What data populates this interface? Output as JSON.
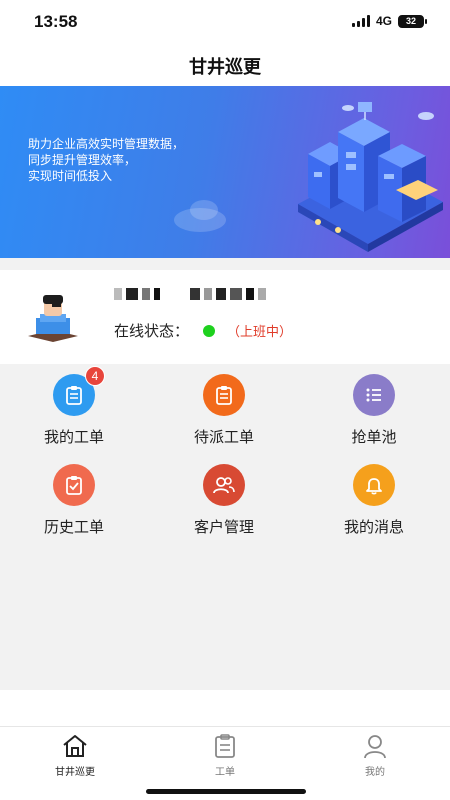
{
  "status_bar": {
    "time": "13:58",
    "network": "4G",
    "battery": "32"
  },
  "header": {
    "title": "甘井巡更"
  },
  "banner": {
    "lines": [
      "助力企业高效实时管理数据，",
      "同步提升管理效率，",
      "实现时间低投入"
    ]
  },
  "user": {
    "status_label": "在线状态：",
    "status_value": "（上班中）",
    "status_color": "#1ed11e"
  },
  "menu": [
    {
      "label": "我的工单",
      "icon": "clipboard-icon",
      "color": "#2e9bf0",
      "badge": "4"
    },
    {
      "label": "待派工单",
      "icon": "clipboard-icon",
      "color": "#f26a1b"
    },
    {
      "label": "抢单池",
      "icon": "list-icon",
      "color": "#8a7cc9"
    },
    {
      "label": "历史工单",
      "icon": "clipboard-check-icon",
      "color": "#f06a4e"
    },
    {
      "label": "客户管理",
      "icon": "users-icon",
      "color": "#d84a33"
    },
    {
      "label": "我的消息",
      "icon": "bell-icon",
      "color": "#f5a01c"
    }
  ],
  "tabs": [
    {
      "label": "甘井巡更",
      "icon": "home-icon",
      "active": true
    },
    {
      "label": "工单",
      "icon": "clipboard-icon",
      "active": false
    },
    {
      "label": "我的",
      "icon": "person-icon",
      "active": false
    }
  ],
  "colors": {
    "banner_start": "#2f8cf5",
    "banner_end": "#7a4fd9",
    "accent_red": "#e03c2a"
  }
}
